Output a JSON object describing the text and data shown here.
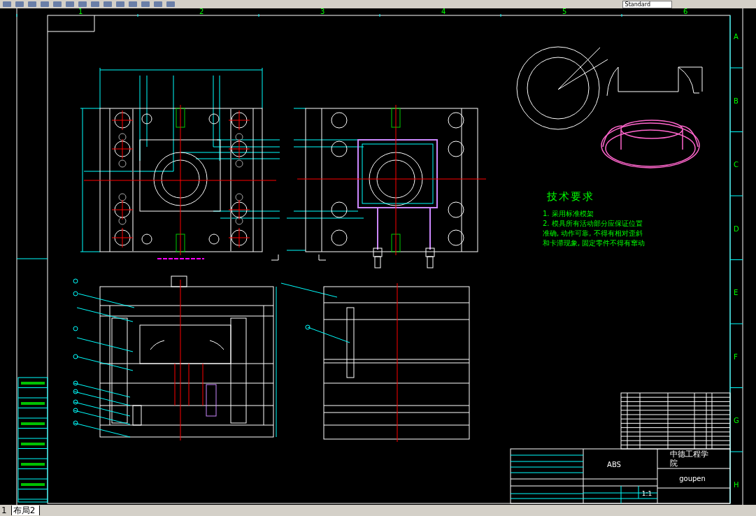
{
  "toolbar": {
    "text_style_dropdown": "Standard"
  },
  "sheet": {
    "column_labels": [
      "1",
      "2",
      "3",
      "4",
      "5",
      "6"
    ],
    "row_labels": [
      "A",
      "B",
      "C",
      "D",
      "E",
      "F",
      "G",
      "H"
    ],
    "technical_requirements": {
      "title": "技术要求",
      "items": [
        "1. 采用标准模架",
        "2. 模具所有活动部分应保证位置准确, 动作可靠, 不得有相对歪斜和卡滞现象, 固定零件不得有窜动"
      ]
    },
    "title_block": {
      "material": "ABS",
      "school": "中德工程学院",
      "designer": "goupen",
      "scale": "1:1"
    }
  },
  "layout_tabs": [
    {
      "label": "1",
      "selected": false
    },
    {
      "label": "布局2",
      "selected": true
    }
  ]
}
